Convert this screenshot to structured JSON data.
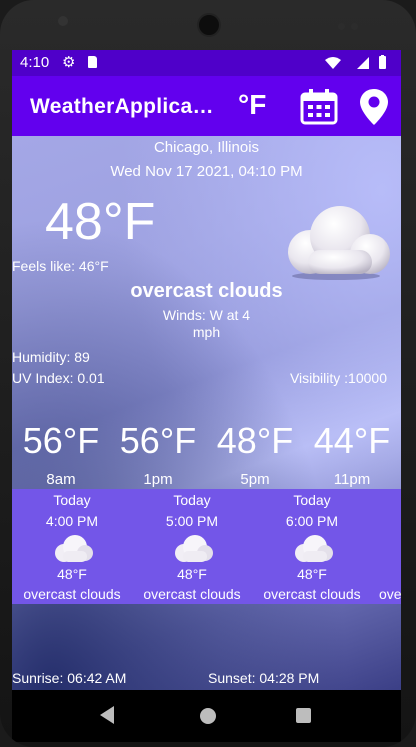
{
  "status_bar": {
    "time": "4:10"
  },
  "app_bar": {
    "title": "WeatherApplication",
    "unit_toggle": "°F"
  },
  "current": {
    "city": "Chicago, Illinois",
    "datetime": "Wed Nov 17 2021, 04:10 PM",
    "temperature": "48°F",
    "feels_like": "Feels like: 46°F",
    "description": "overcast clouds",
    "winds_line1": "Winds: W at 4",
    "winds_line2": "mph",
    "humidity": "Humidity: 89",
    "uv_index": "UV Index: 0.01",
    "visibility": "Visibility :10000",
    "icon": "overcast-cloud-icon"
  },
  "hourly": [
    {
      "temp": "56°F",
      "label": "8am"
    },
    {
      "temp": "56°F",
      "label": "1pm"
    },
    {
      "temp": "48°F",
      "label": "5pm"
    },
    {
      "temp": "44°F",
      "label": "11pm"
    }
  ],
  "forecast": [
    {
      "day": "Today",
      "time": "4:00 PM",
      "temp": "48°F",
      "desc": "overcast clouds"
    },
    {
      "day": "Today",
      "time": "5:00 PM",
      "temp": "48°F",
      "desc": "overcast clouds"
    },
    {
      "day": "Today",
      "time": "6:00 PM",
      "temp": "48°F",
      "desc": "overcast clouds"
    },
    {
      "day": "",
      "time": "",
      "temp": "",
      "desc": "overcast clouds"
    }
  ],
  "sun": {
    "sunrise": "Sunrise: 06:42 AM",
    "sunset": "Sunset: 04:28 PM"
  },
  "colors": {
    "status_bar": "#4f00c9",
    "app_bar": "#6200ee",
    "forecast_strip": "#7356e8"
  }
}
